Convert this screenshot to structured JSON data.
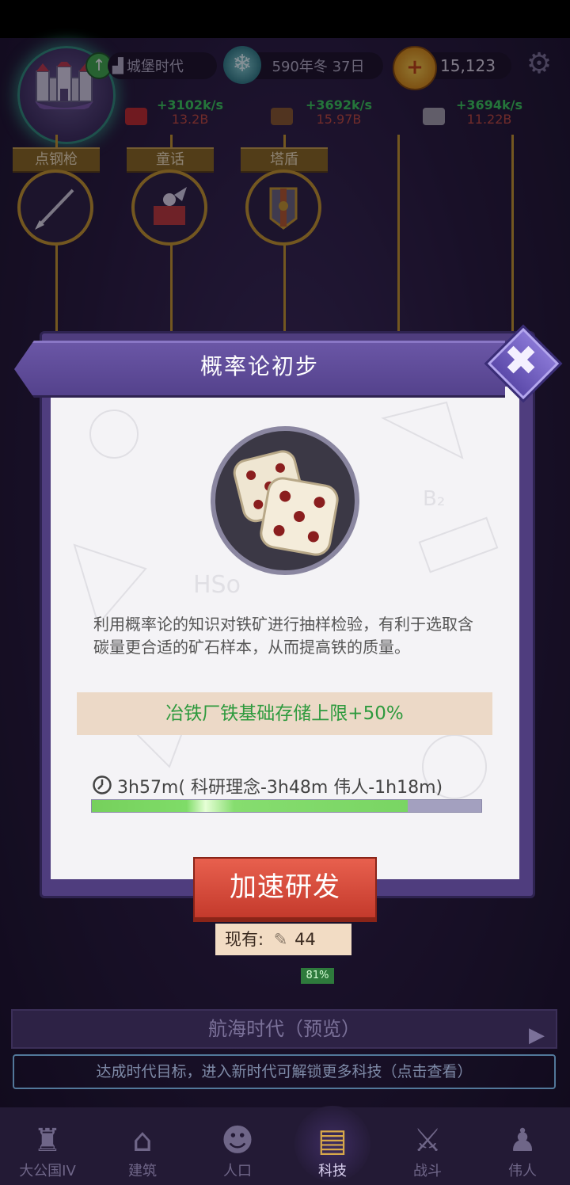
{
  "header": {
    "era_label": "城堡时代",
    "date_label": "590年冬 37日",
    "coin_amount": "15,123",
    "resources": [
      {
        "name": "meat",
        "rate": "+3102k/s",
        "amount": "13.2B"
      },
      {
        "name": "wood",
        "rate": "+3692k/s",
        "amount": "15.97B"
      },
      {
        "name": "stone",
        "rate": "+3694k/s",
        "amount": "11.22B"
      }
    ]
  },
  "tech_tree": {
    "nodes": [
      {
        "label": "点钢枪"
      },
      {
        "label": "童话"
      },
      {
        "label": "塔盾"
      }
    ]
  },
  "dialog": {
    "title": "概率论初步",
    "description": "利用概率论的知识对铁矿进行抽样检验，有利于选取含碳量更合适的矿石样本，从而提高铁的质量。",
    "effect": "冶铁厂铁基础存储上限+50%",
    "timer_text": "3h57m( 科研理念-3h48m 伟人-1h18m)",
    "progress_fraction": 0.81,
    "speed_button": "加速研发",
    "have_label": "现有:",
    "have_count": "44"
  },
  "background": {
    "progress_percent": "81%",
    "era_preview_title": "航海时代",
    "era_preview_suffix": "（预览）",
    "goal_text": "达成时代目标，进入新时代可解锁更多科技（点击查看）"
  },
  "nav": {
    "items": [
      {
        "label": "大公国IV",
        "icon": "castle-icon"
      },
      {
        "label": "建筑",
        "icon": "house-icon"
      },
      {
        "label": "人口",
        "icon": "person-icon"
      },
      {
        "label": "科技",
        "icon": "book-icon",
        "active": true
      },
      {
        "label": "战斗",
        "icon": "swords-icon"
      },
      {
        "label": "伟人",
        "icon": "statue-icon"
      }
    ]
  },
  "colors": {
    "dialog_purple": "#54428c",
    "effect_green": "#2e9a3e",
    "button_red": "#d04a38",
    "gold": "#c89a2a"
  }
}
